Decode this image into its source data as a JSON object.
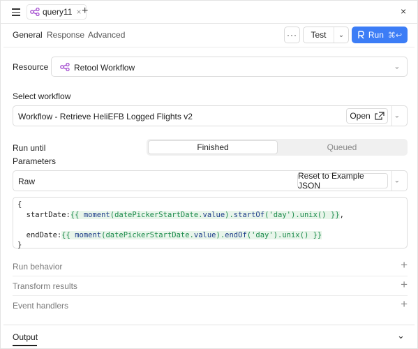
{
  "tab": {
    "title": "query11",
    "close": "×",
    "add": "+"
  },
  "window": {
    "close": "×"
  },
  "subtabs": [
    "General",
    "Response",
    "Advanced"
  ],
  "toolbar": {
    "more": "···",
    "test_label": "Test",
    "run_label": "Run",
    "run_shortcut": "⌘↩"
  },
  "resource": {
    "label": "Resource",
    "value": "Retool Workflow"
  },
  "workflow": {
    "label": "Select workflow",
    "value": "Workflow - Retrieve HeliEFB Logged Flights v2",
    "open_label": "Open"
  },
  "run_until": {
    "label": "Run until",
    "options": [
      "Finished",
      "Queued"
    ],
    "selected": "Finished"
  },
  "parameters": {
    "label": "Parameters",
    "mode": "Raw",
    "reset_label": "Reset to Example JSON"
  },
  "code": {
    "open": "{",
    "l1_key": "  startDate:",
    "l1_tpl_open": "{{ ",
    "l1_fn": "moment",
    "l1_mid": "(datePickerStartDate.",
    "l1_prop": "value",
    "l1_after": ").",
    "l1_method": "startOf",
    "l1_paren": "(",
    "l1_str": "'day'",
    "l1_tail": ").unix() ",
    "l1_tpl_close": "}}",
    "l1_comma": ",",
    "l2_key": "  endDate:",
    "l2_tpl_open": "{{ ",
    "l2_fn": "moment",
    "l2_mid": "(datePickerStartDate.",
    "l2_prop": "value",
    "l2_after": ").",
    "l2_method": "endOf",
    "l2_paren": "(",
    "l2_str": "'day'",
    "l2_tail": ").unix() ",
    "l2_tpl_close": "}}",
    "close": "}"
  },
  "sections": [
    "Run behavior",
    "Transform results",
    "Event handlers"
  ],
  "output": {
    "label": "Output"
  },
  "colors": {
    "accent": "#3c7df6",
    "workflow_icon": "#a34bd0"
  }
}
